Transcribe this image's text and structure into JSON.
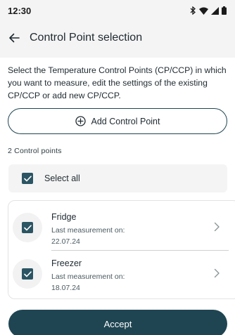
{
  "status_bar": {
    "time": "12:30",
    "icons": [
      "bluetooth-icon",
      "wifi-icon",
      "signal-icon",
      "battery-icon"
    ]
  },
  "app_bar": {
    "back_icon": "arrow-left-icon",
    "title": "Control Point selection"
  },
  "intro_text": "Select the Temperature Control Points (CP/CCP) in which you want to measure, edit the settings of the existing CP/CCP or add new CP/CCP.",
  "add_button": {
    "icon": "plus-circle-icon",
    "label": "Add Control Point"
  },
  "count_label": "2 Control points",
  "select_all": {
    "label": "Select all",
    "checked": true
  },
  "control_points": [
    {
      "name": "Fridge",
      "last_label": "Last measurement on:",
      "date": "22.07.24",
      "checked": true
    },
    {
      "name": "Freezer",
      "last_label": "Last measurement on:",
      "date": "18.07.24",
      "checked": true
    }
  ],
  "accept_button": {
    "label": "Accept"
  },
  "colors": {
    "primary": "#1f4552",
    "checkbox": "#2b5563",
    "surface": "#f4f4f4",
    "text": "#1f2a30"
  }
}
